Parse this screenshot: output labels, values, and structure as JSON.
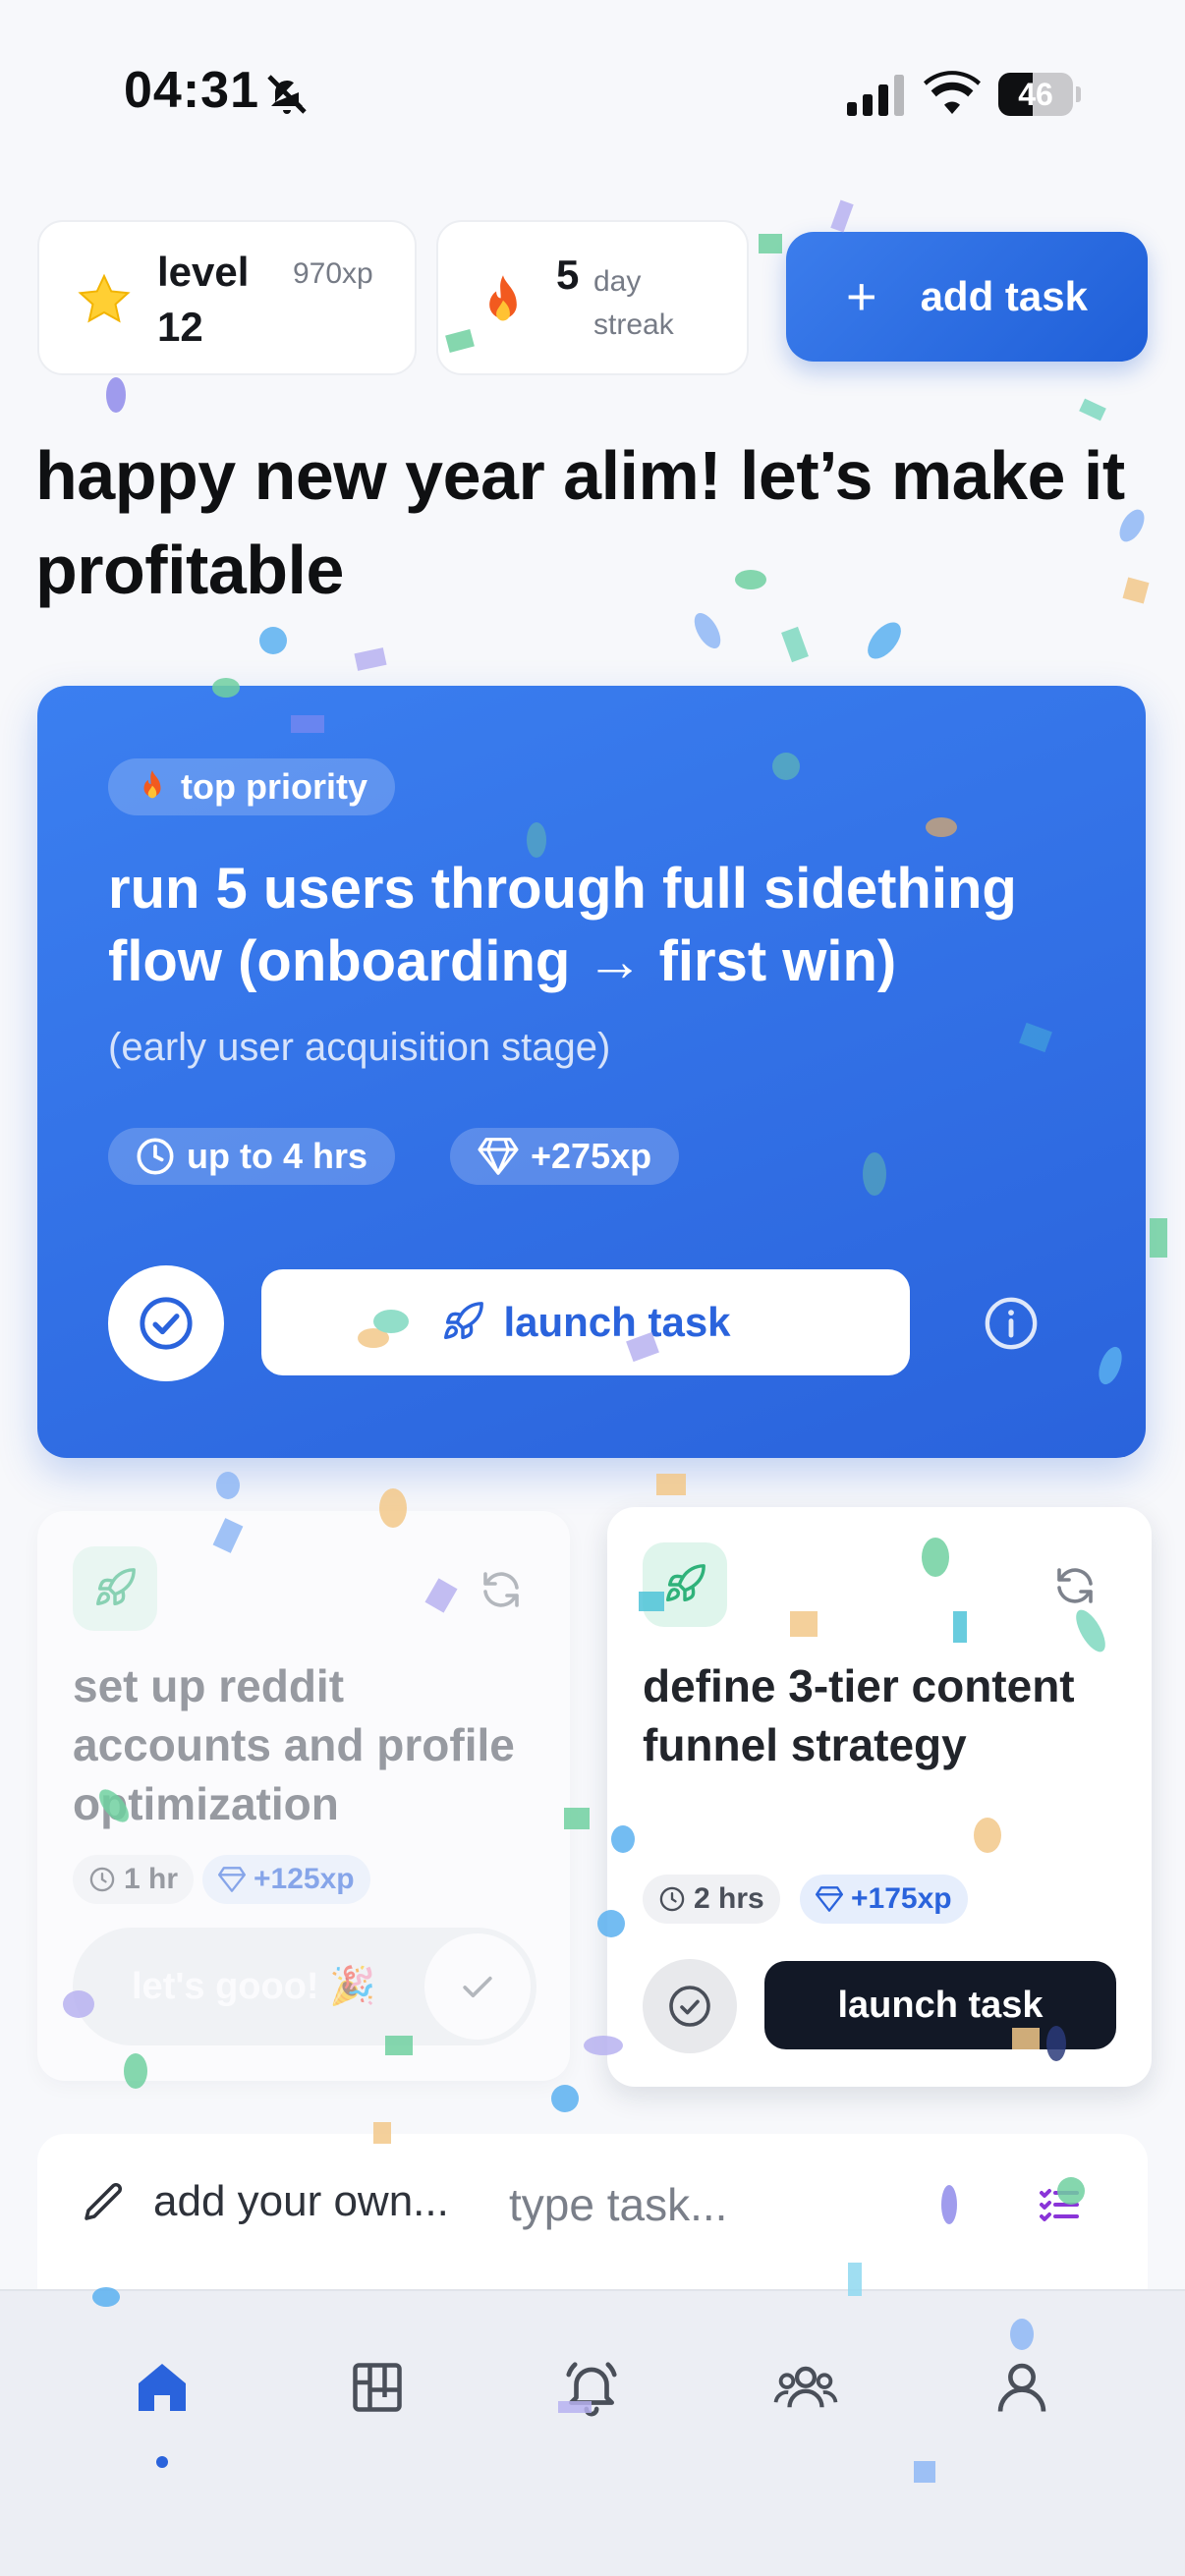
{
  "status_bar": {
    "time": "04:31",
    "battery": "46"
  },
  "stats": {
    "level_label": "level",
    "level_value": "12",
    "level_xp": "970xp",
    "streak_value": "5",
    "streak_unit_1": "day",
    "streak_unit_2": "streak"
  },
  "header": {
    "add_task_label": "add task"
  },
  "greeting": "happy new year alim! let’s make it profitable",
  "hero": {
    "badge": "top priority",
    "title": "run 5 users through full sidething flow (onboarding → first win)",
    "subtitle": "(early user acquisition stage)",
    "time": "up to 4 hrs",
    "xp": "+275xp",
    "launch_label": "launch task"
  },
  "tasks": [
    {
      "title": "set up reddit accounts and profile optimization",
      "time": "1 hr",
      "xp": "+125xp",
      "action_label": "let's gooo! 🎉",
      "state": "completed"
    },
    {
      "title": "define 3-tier content funnel strategy",
      "time": "2 hrs",
      "xp": "+175xp",
      "action_label": "launch task",
      "state": "active"
    }
  ],
  "add_own": {
    "label": "add your own...",
    "placeholder": "type task..."
  },
  "nav": {
    "items": [
      "home-icon",
      "board-icon",
      "bell-icon",
      "group-icon",
      "profile-icon"
    ],
    "active": "home-icon"
  },
  "colors": {
    "accent": "#2a63dc",
    "hero_bg": "#3b7ff0",
    "dark_button": "#121826",
    "mint": "#dff5ec"
  }
}
